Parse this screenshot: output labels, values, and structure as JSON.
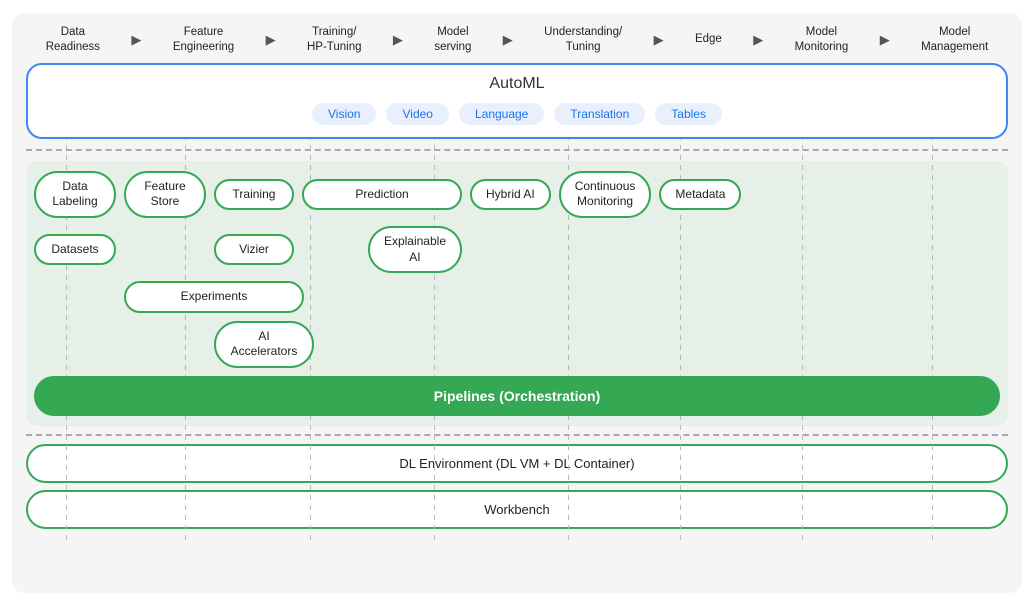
{
  "nav": {
    "items": [
      {
        "label": "Data\nReadiness",
        "id": "data-readiness"
      },
      {
        "label": "Feature\nEngineering",
        "id": "feature-engineering"
      },
      {
        "label": "Training/\nHP-Tuning",
        "id": "training-hp-tuning"
      },
      {
        "label": "Model\nserving",
        "id": "model-serving"
      },
      {
        "label": "Understanding/\nTuning",
        "id": "understanding-tuning"
      },
      {
        "label": "Edge",
        "id": "edge"
      },
      {
        "label": "Model\nMonitoring",
        "id": "model-monitoring"
      },
      {
        "label": "Model\nManagement",
        "id": "model-management"
      }
    ]
  },
  "automl": {
    "title": "AutoML",
    "pills": [
      "Vision",
      "Video",
      "Language",
      "Translation",
      "Tables"
    ]
  },
  "middle": {
    "row1": [
      {
        "label": "Data\nLabeling"
      },
      {
        "label": "Feature\nStore"
      },
      {
        "label": "Training"
      },
      {
        "label": "Prediction"
      },
      {
        "label": "Hybrid AI"
      },
      {
        "label": "Continuous\nMonitoring"
      },
      {
        "label": "Metadata"
      }
    ],
    "row2_left": [
      {
        "label": "Datasets"
      }
    ],
    "row2_mid_left": [
      {
        "label": "Vizier"
      }
    ],
    "row2_mid_right": [
      {
        "label": "Explainable\nAI"
      }
    ],
    "row3": [
      {
        "label": "Experiments"
      }
    ],
    "row4": [
      {
        "label": "AI\nAccelerators"
      }
    ],
    "pipelines": "Pipelines (Orchestration)"
  },
  "bottom": {
    "dl_env": "DL Environment (DL VM + DL Container)",
    "workbench": "Workbench"
  }
}
